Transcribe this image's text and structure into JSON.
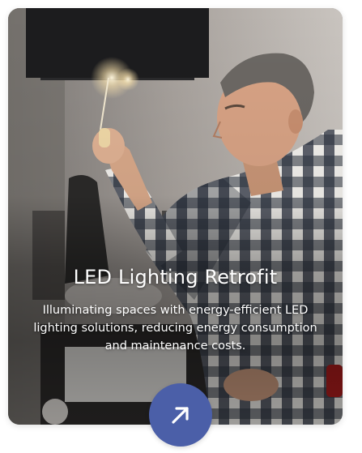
{
  "card": {
    "title": "LED Lighting Retrofit",
    "description": "Illuminating spaces with energy-efficient LED lighting solutions, reducing energy consumption and maintenance costs.",
    "photo_subject": "technician-inspecting-ceiling-light",
    "arrow_icon": "arrow-up-right-icon"
  },
  "colors": {
    "button_background": "#4b5fa8",
    "text": "#ffffff",
    "lamp_shade": "#1c1c1e"
  }
}
